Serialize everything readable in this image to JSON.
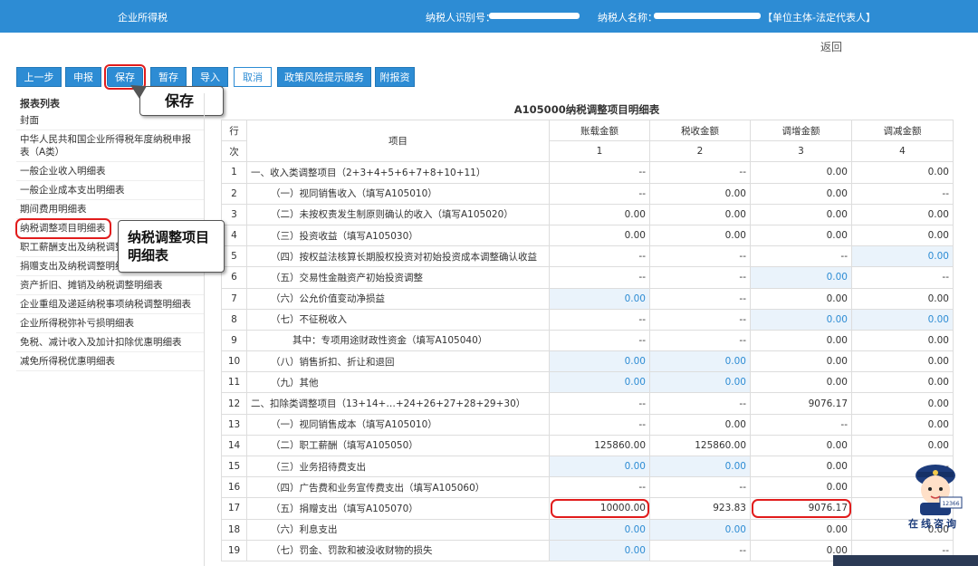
{
  "topbar": {
    "app_name": "企业所得税",
    "taxpayer_id_label": "纳税人识别号：",
    "taxpayer_name_label": "纳税人名称：",
    "role": "【单位主体-法定代表人】"
  },
  "back_label": "返回",
  "toolbar": {
    "prev": "上一步",
    "declare": "申报",
    "save": "保存",
    "temp_save": "暂存",
    "import": "导入",
    "cancel": "取消",
    "policy": "政策风险提示服务",
    "attach": "附报资料"
  },
  "callouts": {
    "save": "保存",
    "tax_adjust": "纳税调整项目明细表"
  },
  "sidebar": {
    "header": "报表列表",
    "items": [
      "封面",
      "中华人民共和国企业所得税年度纳税申报表（A类）",
      "一般企业收入明细表",
      "一般企业成本支出明细表",
      "期间费用明细表",
      "纳税调整项目明细表",
      "职工薪酬支出及纳税调整明细表",
      "捐赠支出及纳税调整明细表",
      "资产折旧、摊销及纳税调整明细表",
      "企业重组及递延纳税事项纳税调整明细表",
      "企业所得税弥补亏损明细表",
      "免税、减计收入及加计扣除优惠明细表",
      "减免所得税优惠明细表"
    ]
  },
  "table": {
    "title": "A105000纳税调整项目明细表",
    "header": {
      "row_label_1": "行",
      "row_label_2": "次",
      "item": "项目",
      "col1": "账载金额",
      "col2": "税收金额",
      "col3": "调增金额",
      "col4": "调减金额",
      "n1": "1",
      "n2": "2",
      "n3": "3",
      "n4": "4"
    },
    "rows": [
      {
        "no": "1",
        "item": "一、收入类调整项目（2+3+4+5+6+7+8+10+11）",
        "indent": 0,
        "c1": "--",
        "c2": "--",
        "c3": "0.00",
        "c4": "0.00",
        "blue": []
      },
      {
        "no": "2",
        "item": "（一）视同销售收入（填写A105010）",
        "indent": 1,
        "c1": "--",
        "c2": "0.00",
        "c3": "0.00",
        "c4": "--",
        "blue": []
      },
      {
        "no": "3",
        "item": "（二）未按权责发生制原则确认的收入（填写A105020）",
        "indent": 1,
        "c1": "0.00",
        "c2": "0.00",
        "c3": "0.00",
        "c4": "0.00",
        "blue": []
      },
      {
        "no": "4",
        "item": "（三）投资收益（填写A105030）",
        "indent": 1,
        "c1": "0.00",
        "c2": "0.00",
        "c3": "0.00",
        "c4": "0.00",
        "blue": []
      },
      {
        "no": "5",
        "item": "（四）按权益法核算长期股权投资对初始投资成本调整确认收益",
        "indent": 1,
        "c1": "--",
        "c2": "--",
        "c3": "--",
        "c4": "0.00",
        "blue": [
          "c4"
        ]
      },
      {
        "no": "6",
        "item": "（五）交易性金融资产初始投资调整",
        "indent": 1,
        "c1": "--",
        "c2": "--",
        "c3": "0.00",
        "c4": "--",
        "blue": [
          "c3"
        ]
      },
      {
        "no": "7",
        "item": "（六）公允价值变动净损益",
        "indent": 1,
        "c1": "0.00",
        "c2": "--",
        "c3": "0.00",
        "c4": "0.00",
        "blue": [
          "c1"
        ]
      },
      {
        "no": "8",
        "item": "（七）不征税收入",
        "indent": 1,
        "c1": "--",
        "c2": "--",
        "c3": "0.00",
        "c4": "0.00",
        "blue": [
          "c3",
          "c4"
        ]
      },
      {
        "no": "9",
        "item": "其中：专项用途财政性资金（填写A105040）",
        "indent": 2,
        "c1": "--",
        "c2": "--",
        "c3": "0.00",
        "c4": "0.00",
        "blue": []
      },
      {
        "no": "10",
        "item": "（八）销售折扣、折让和退回",
        "indent": 1,
        "c1": "0.00",
        "c2": "0.00",
        "c3": "0.00",
        "c4": "0.00",
        "blue": [
          "c1",
          "c2"
        ]
      },
      {
        "no": "11",
        "item": "（九）其他",
        "indent": 1,
        "c1": "0.00",
        "c2": "0.00",
        "c3": "0.00",
        "c4": "0.00",
        "blue": [
          "c1",
          "c2"
        ]
      },
      {
        "no": "12",
        "item": "二、扣除类调整项目（13+14+…+24+26+27+28+29+30）",
        "indent": 0,
        "c1": "--",
        "c2": "--",
        "c3": "9076.17",
        "c4": "0.00",
        "blue": []
      },
      {
        "no": "13",
        "item": "（一）视同销售成本（填写A105010）",
        "indent": 1,
        "c1": "--",
        "c2": "0.00",
        "c3": "--",
        "c4": "0.00",
        "blue": []
      },
      {
        "no": "14",
        "item": "（二）职工薪酬（填写A105050）",
        "indent": 1,
        "c1": "125860.00",
        "c2": "125860.00",
        "c3": "0.00",
        "c4": "0.00",
        "blue": []
      },
      {
        "no": "15",
        "item": "（三）业务招待费支出",
        "indent": 1,
        "c1": "0.00",
        "c2": "0.00",
        "c3": "0.00",
        "c4": "--",
        "blue": [
          "c1",
          "c2"
        ]
      },
      {
        "no": "16",
        "item": "（四）广告费和业务宣传费支出（填写A105060）",
        "indent": 1,
        "c1": "--",
        "c2": "--",
        "c3": "0.00",
        "c4": "0.00",
        "blue": []
      },
      {
        "no": "17",
        "item": "（五）捐赠支出（填写A105070）",
        "indent": 1,
        "c1": "10000.00",
        "c2": "923.83",
        "c3": "9076.17",
        "c4": "0.00",
        "blue": []
      },
      {
        "no": "18",
        "item": "（六）利息支出",
        "indent": 1,
        "c1": "0.00",
        "c2": "0.00",
        "c3": "0.00",
        "c4": "0.00",
        "blue": [
          "c1",
          "c2"
        ]
      },
      {
        "no": "19",
        "item": "（七）罚金、罚款和被没收财物的损失",
        "indent": 1,
        "c1": "0.00",
        "c2": "--",
        "c3": "0.00",
        "c4": "--",
        "blue": [
          "c1"
        ]
      }
    ]
  },
  "mascot_text": "在线咨询",
  "mascot_badge": "12366",
  "colors": {
    "brand": "#2d8cd4",
    "highlight": "#e11c1c",
    "input_bg": "#eaf3fb"
  }
}
